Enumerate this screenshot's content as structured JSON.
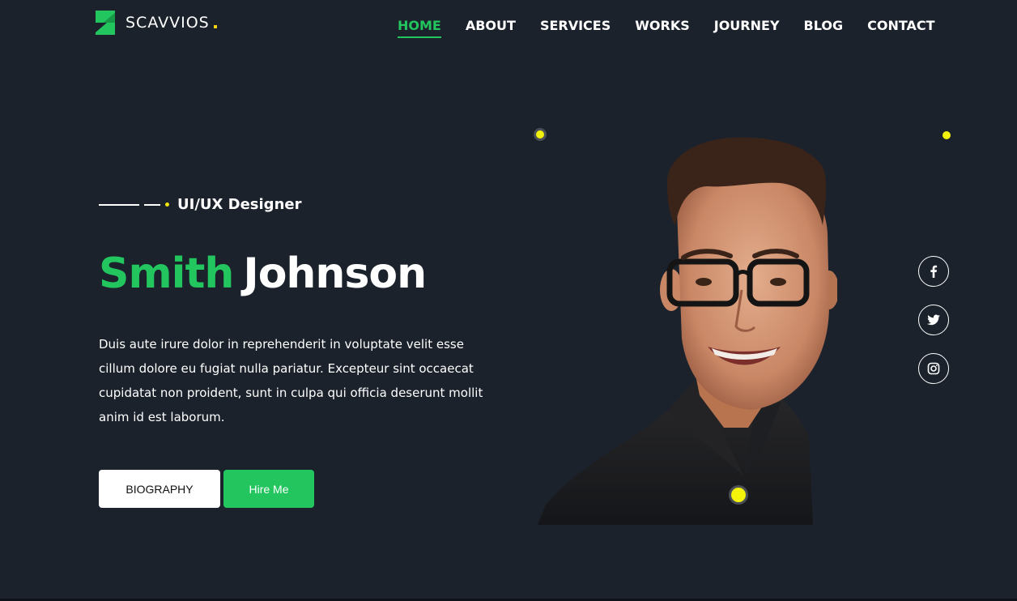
{
  "brand": {
    "name": "SCAVVIOS",
    "accent_color": "#22c55e",
    "dot_color": "#f2d410",
    "logo_icon": "logo-mark-icon"
  },
  "nav": {
    "items": [
      {
        "label": "HOME",
        "active": true
      },
      {
        "label": "ABOUT",
        "active": false
      },
      {
        "label": "SERVICES",
        "active": false
      },
      {
        "label": "WORKS",
        "active": false
      },
      {
        "label": "JOURNEY",
        "active": false
      },
      {
        "label": "BLOG",
        "active": false
      },
      {
        "label": "CONTACT",
        "active": false
      }
    ]
  },
  "hero": {
    "role": "UI/UX Designer",
    "first_name": "Smith",
    "last_name": "Johnson",
    "description": "Duis aute irure dolor in reprehenderit in voluptate velit esse cillum dolore eu fugiat nulla pariatur. Excepteur sint occaecat cupidatat non proident, sunt in culpa qui officia deserunt mollit anim id est laborum.",
    "buttons": {
      "biography": "BIOGRAPHY",
      "hire": "Hire Me"
    }
  },
  "social": [
    {
      "icon": "facebook-icon"
    },
    {
      "icon": "twitter-icon"
    },
    {
      "icon": "instagram-icon"
    }
  ],
  "colors": {
    "background": "#1b222c",
    "primary": "#22c55e",
    "highlight": "#f2f20a",
    "text": "#ffffff"
  }
}
